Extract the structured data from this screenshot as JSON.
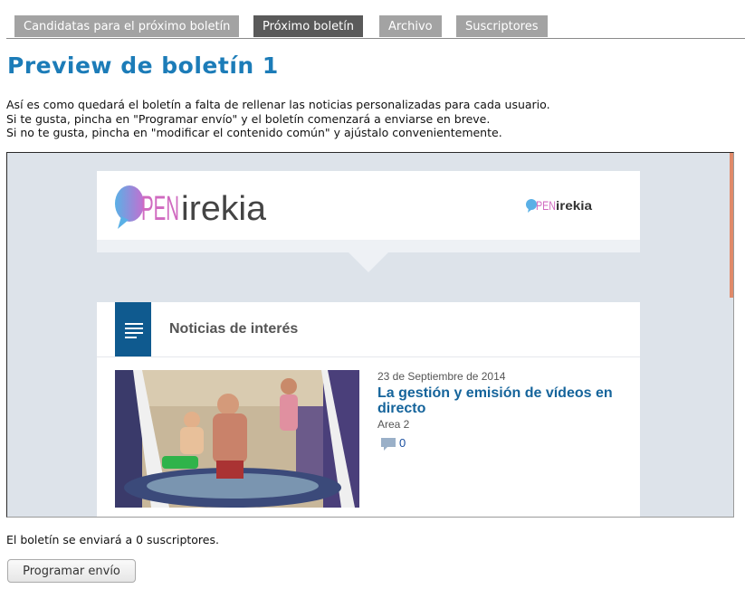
{
  "tabs": [
    {
      "label": "Candidatas para el próximo boletín",
      "active": false
    },
    {
      "label": "Próximo boletín",
      "active": true
    },
    {
      "label": "Archivo",
      "active": false
    },
    {
      "label": "Suscriptores",
      "active": false
    }
  ],
  "page_title": "Preview de boletín 1",
  "intro": [
    "Así es como quedará el boletín a falta de rellenar las noticias personalizadas para cada usuario.",
    "Si te gusta, pincha en \"Programar envío\" y el boletín comenzará a enviarse en breve.",
    "Si no te gusta, pincha en \"modificar el contenido común\" y ajústalo convenientemente."
  ],
  "preview": {
    "logo_text_open": "PEN",
    "logo_text_irekia": "irekia",
    "section_title": "Noticias de interés",
    "news": {
      "date": "23 de Septiembre de 2014",
      "headline": "La gestión y emisión de vídeos en directo",
      "area": "Area 2",
      "comments": "0"
    }
  },
  "footer_text": "El boletín se enviará a 0 suscriptores.",
  "schedule_button": "Programar envío",
  "colors": {
    "accent": "#1c7cb8",
    "tab_active": "#5a5a5a",
    "tab_inactive": "#a3a3a3",
    "news_box": "#0f5a8f"
  }
}
